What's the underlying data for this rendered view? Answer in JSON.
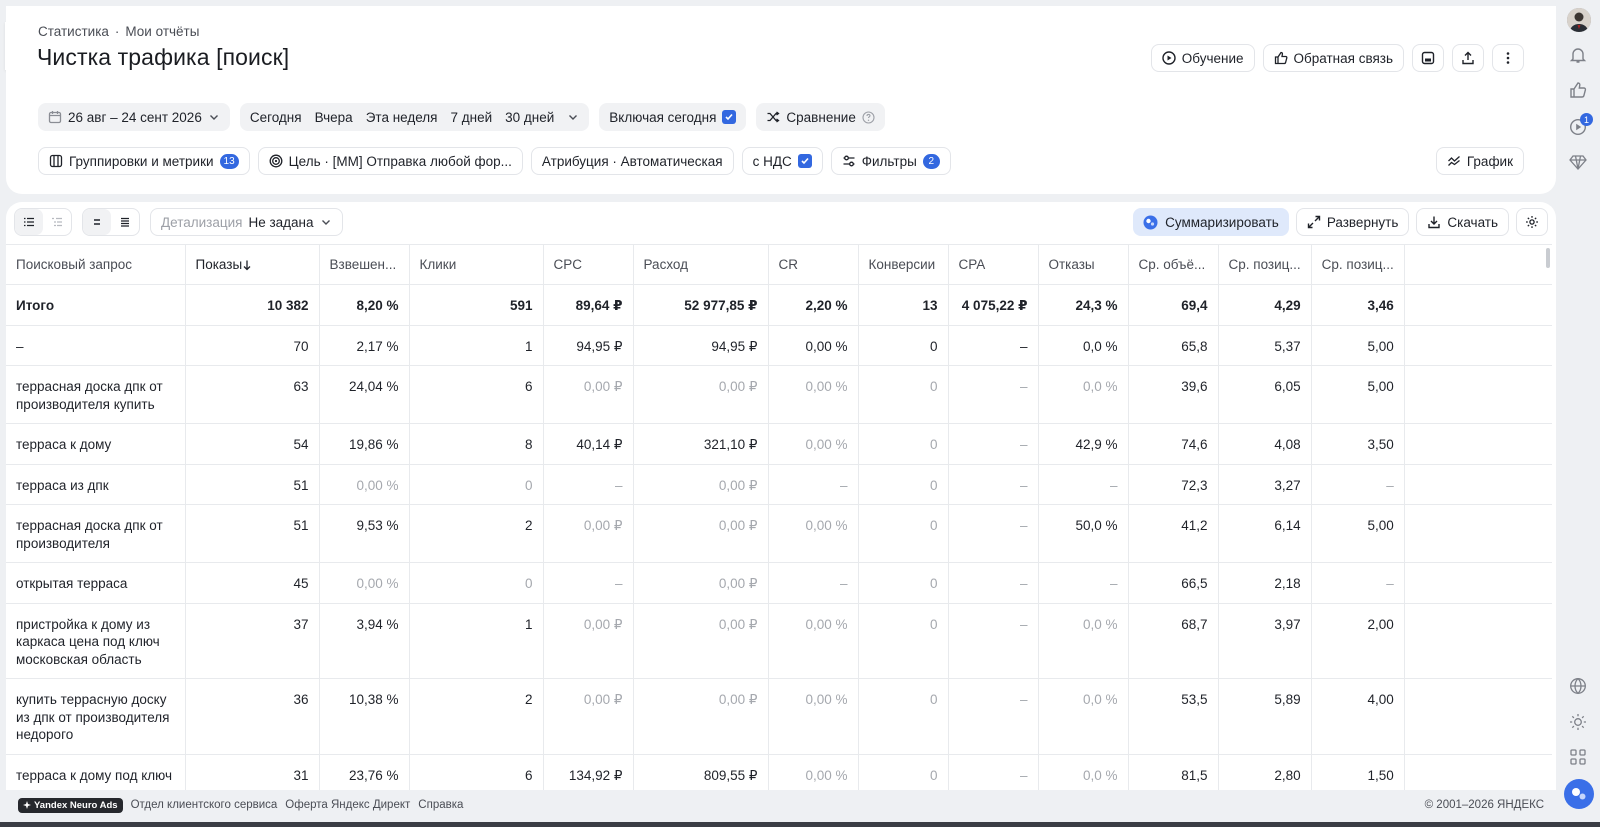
{
  "breadcrumb": {
    "root": "Статистика",
    "separator": "·",
    "current": "Мои отчёты"
  },
  "title": "Чистка трафика [поиск]",
  "top_actions": {
    "learn": "Обучение",
    "feedback": "Обратная связь"
  },
  "date_range": "26 авг – 24 сент 2026",
  "periods": [
    "Сегодня",
    "Вчера",
    "Эта неделя",
    "7 дней",
    "30 дней"
  ],
  "include_today": "Включая сегодня",
  "compare": "Сравнение",
  "groupings": {
    "label": "Группировки и метрики",
    "count": "13"
  },
  "goal": "Цель · [ММ] Отправка любой фор...",
  "attribution": "Атрибуция · Автоматическая",
  "vat": "с НДС",
  "filters": {
    "label": "Фильтры",
    "count": "2"
  },
  "chart_button": "График",
  "detail": {
    "label": "Детализация",
    "value": "Не задана"
  },
  "table_actions": {
    "summarize": "Суммаризировать",
    "expand": "Развернуть",
    "download": "Скачать"
  },
  "columns": [
    "Поисковый запрос",
    "Показы",
    "Взвешен...",
    "Клики",
    "CPC",
    "Расход",
    "CR",
    "Конверсии",
    "CPA",
    "Отказы",
    "Ср. объё...",
    "Ср. позиц...",
    "Ср. позиц..."
  ],
  "total": [
    "Итого",
    "10 382",
    "8,20 %",
    "591",
    "89,64 ₽",
    "52 977,85 ₽",
    "2,20 %",
    "13",
    "4 075,22 ₽",
    "24,3 %",
    "69,4",
    "4,29",
    "3,46"
  ],
  "rows": [
    [
      "–",
      "70",
      "2,17 %",
      "1",
      "94,95 ₽",
      "94,95 ₽",
      "0,00 %",
      "0",
      "–",
      "0,0 %",
      "65,8",
      "5,37",
      "5,00"
    ],
    [
      "террасная доска дпк от производителя купить",
      "63",
      "24,04 %",
      "6",
      "0,00 ₽",
      "0,00 ₽",
      "0,00 %",
      "0",
      "–",
      "0,0 %",
      "39,6",
      "6,05",
      "5,00"
    ],
    [
      "терраса к дому",
      "54",
      "19,86 %",
      "8",
      "40,14 ₽",
      "321,10 ₽",
      "0,00 %",
      "0",
      "–",
      "42,9 %",
      "74,6",
      "4,08",
      "3,50"
    ],
    [
      "терраса из дпк",
      "51",
      "0,00 %",
      "0",
      "–",
      "0,00 ₽",
      "–",
      "0",
      "–",
      "–",
      "72,3",
      "3,27",
      "–"
    ],
    [
      "террасная доска дпк от производителя",
      "51",
      "9,53 %",
      "2",
      "0,00 ₽",
      "0,00 ₽",
      "0,00 %",
      "0",
      "–",
      "50,0 %",
      "41,2",
      "6,14",
      "5,00"
    ],
    [
      "открытая терраса",
      "45",
      "0,00 %",
      "0",
      "–",
      "0,00 ₽",
      "–",
      "0",
      "–",
      "–",
      "66,5",
      "2,18",
      "–"
    ],
    [
      "пристройка к дому из каркаса цена под ключ московская область",
      "37",
      "3,94 %",
      "1",
      "0,00 ₽",
      "0,00 ₽",
      "0,00 %",
      "0",
      "–",
      "0,0 %",
      "68,7",
      "3,97",
      "2,00"
    ],
    [
      "купить террасную доску из дпк от производителя недорого",
      "36",
      "10,38 %",
      "2",
      "0,00 ₽",
      "0,00 ₽",
      "0,00 %",
      "0",
      "–",
      "0,0 %",
      "53,5",
      "5,89",
      "4,00"
    ],
    [
      "терраса к дому под ключ",
      "31",
      "23,76 %",
      "6",
      "134,92 ₽",
      "809,55 ₽",
      "0,00 %",
      "0",
      "–",
      "0,0 %",
      "81,5",
      "2,80",
      "1,50"
    ]
  ],
  "dim_cells": [
    [],
    [],
    [
      4,
      5,
      6,
      7,
      8,
      9
    ],
    [
      6,
      7,
      8
    ],
    [
      2,
      3,
      4,
      5,
      6,
      7,
      8,
      9,
      12
    ],
    [
      4,
      5,
      6,
      7,
      8
    ],
    [
      2,
      3,
      4,
      5,
      6,
      7,
      8,
      9,
      12
    ],
    [
      4,
      5,
      6,
      7,
      8,
      9
    ],
    [
      4,
      5,
      6,
      7,
      8,
      9
    ],
    [
      6,
      7,
      8,
      9
    ]
  ],
  "footer": {
    "badge": "Yandex Neuro Ads",
    "links": [
      "Отдел клиентского сервиса",
      "Оферта Яндекс Директ",
      "Справка"
    ],
    "copyright": "© 2001–2026 ЯНДЕКС"
  },
  "rail": {
    "notification_count": "1"
  },
  "colors": {
    "accent": "#3368e0",
    "summarize_bg": "#dfe9fb"
  }
}
